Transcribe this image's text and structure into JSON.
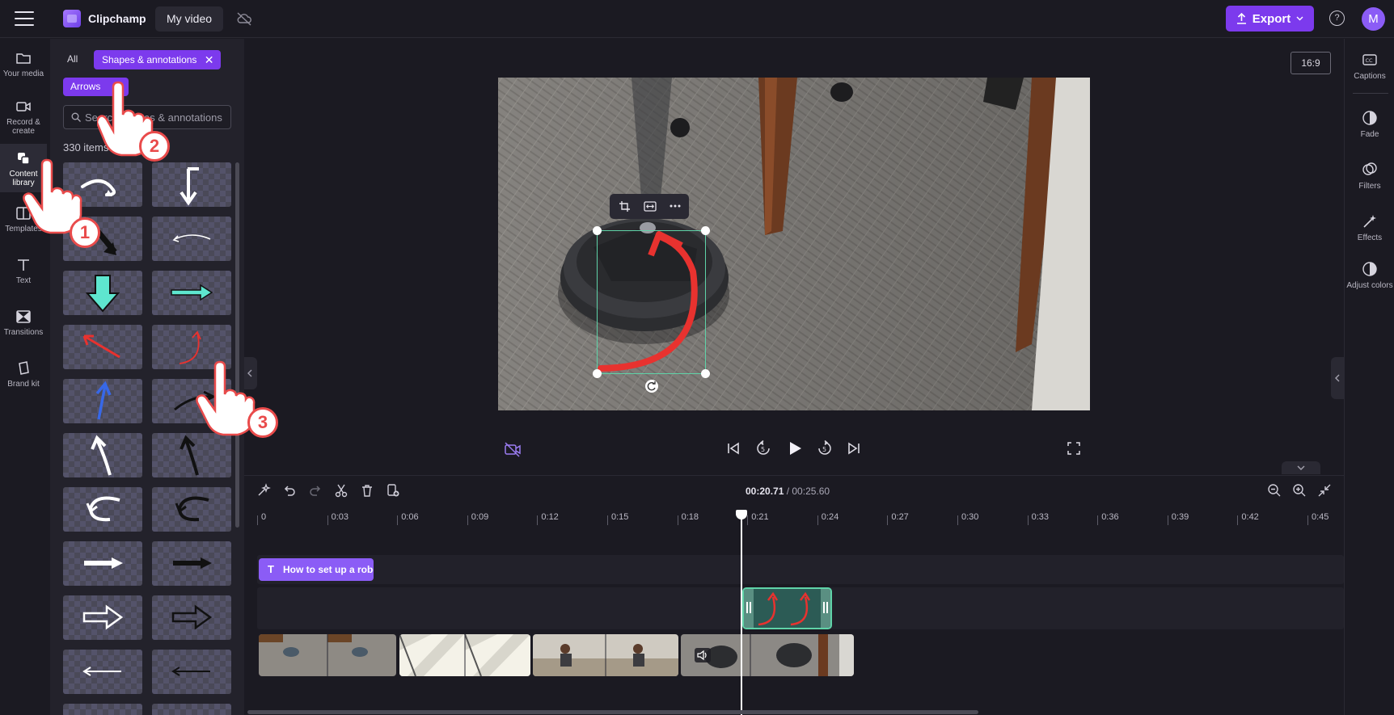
{
  "topbar": {
    "app_name": "Clipchamp",
    "project_name": "My video",
    "export_label": "Export",
    "help_label": "?",
    "avatar_initial": "M"
  },
  "left_rail": {
    "items": [
      {
        "label": "Your media",
        "icon": "folder-icon"
      },
      {
        "label": "Record & create",
        "icon": "camera-icon"
      },
      {
        "label": "Content library",
        "icon": "library-icon"
      },
      {
        "label": "Templates",
        "icon": "templates-icon"
      },
      {
        "label": "Text",
        "icon": "text-icon"
      },
      {
        "label": "Transitions",
        "icon": "transitions-icon"
      },
      {
        "label": "Brand kit",
        "icon": "brand-icon"
      }
    ]
  },
  "library": {
    "filter_all": "All",
    "filter_active": "Shapes & annotations",
    "sub_filter": "Arrows",
    "search_placeholder": "Search shapes & annotations",
    "items_count": "330 items"
  },
  "preview": {
    "aspect_ratio": "16:9"
  },
  "right_rail": {
    "items": [
      {
        "label": "Captions",
        "icon": "captions-icon"
      },
      {
        "label": "Fade",
        "icon": "fade-icon"
      },
      {
        "label": "Filters",
        "icon": "filters-icon"
      },
      {
        "label": "Effects",
        "icon": "effects-icon"
      },
      {
        "label": "Adjust colors",
        "icon": "adjust-icon"
      }
    ]
  },
  "timeline": {
    "current_time": "00:20.71",
    "total_time": "/ 00:25.60",
    "ruler_labels": [
      "0",
      "0:03",
      "0:06",
      "0:09",
      "0:12",
      "0:15",
      "0:18",
      "0:21",
      "0:24",
      "0:27",
      "0:30",
      "0:33",
      "0:36",
      "0:39",
      "0:42",
      "0:45"
    ],
    "text_clip_label": "How to set up a robot vacuum"
  },
  "callouts": [
    "1",
    "2",
    "3"
  ],
  "colors": {
    "accent": "#7c3aed",
    "sticker_arrow": "#e8322f",
    "selection": "#5fd3a8",
    "callout": "#e94b4b"
  }
}
